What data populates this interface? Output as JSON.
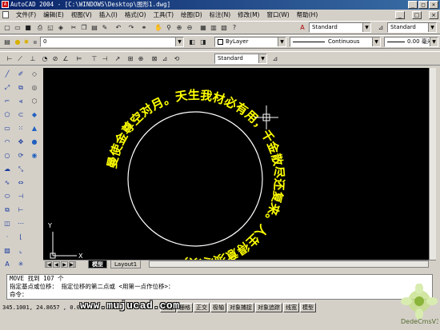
{
  "window": {
    "title": "AutoCAD 2004 - [C:\\WINDOWS\\Desktop\\图形1.dwg]",
    "app_icon": "autocad-logo-icon"
  },
  "window_buttons": [
    "_",
    "□",
    "×"
  ],
  "doc_buttons": [
    "_",
    "□",
    "×"
  ],
  "menu": [
    "文件(F)",
    "编辑(E)",
    "视图(V)",
    "插入(I)",
    "格式(O)",
    "工具(T)",
    "绘图(D)",
    "标注(N)",
    "修改(M)",
    "窗口(W)",
    "帮助(H)"
  ],
  "toolbar": {
    "text_style": "Standard",
    "dim_style": "Standard",
    "layer": "0",
    "color": "ByLayer",
    "linetype": "Continuous",
    "lineweight": "0.00 毫米",
    "dim_style2": "Standard"
  },
  "drawing": {
    "arc_text": "曼使金尊空对月。天生我材必有用，千金散尽还复来。人生得意须尽欢，",
    "circle_color": "#ffffff",
    "text_color": "#ffff00",
    "ucs_y": "Y",
    "ucs_x": "X"
  },
  "tabs": {
    "model": "模型",
    "layout": "Layout1"
  },
  "command": {
    "line1": "MOVE 找到 107 个",
    "line2": "指定基点或位移： 指定位移的第二点或 <用第一点作位移>：",
    "line3": "命令："
  },
  "status": {
    "coords": "345.1001, 24.8657 , 0.0000",
    "buttons": [
      "捕捉",
      "栅格",
      "正交",
      "极轴",
      "对象捕捉",
      "对象追踪",
      "线宽",
      "模型"
    ]
  },
  "watermark": {
    "url": "www.mujucad.com",
    "brand": "DedeCmsV3"
  }
}
